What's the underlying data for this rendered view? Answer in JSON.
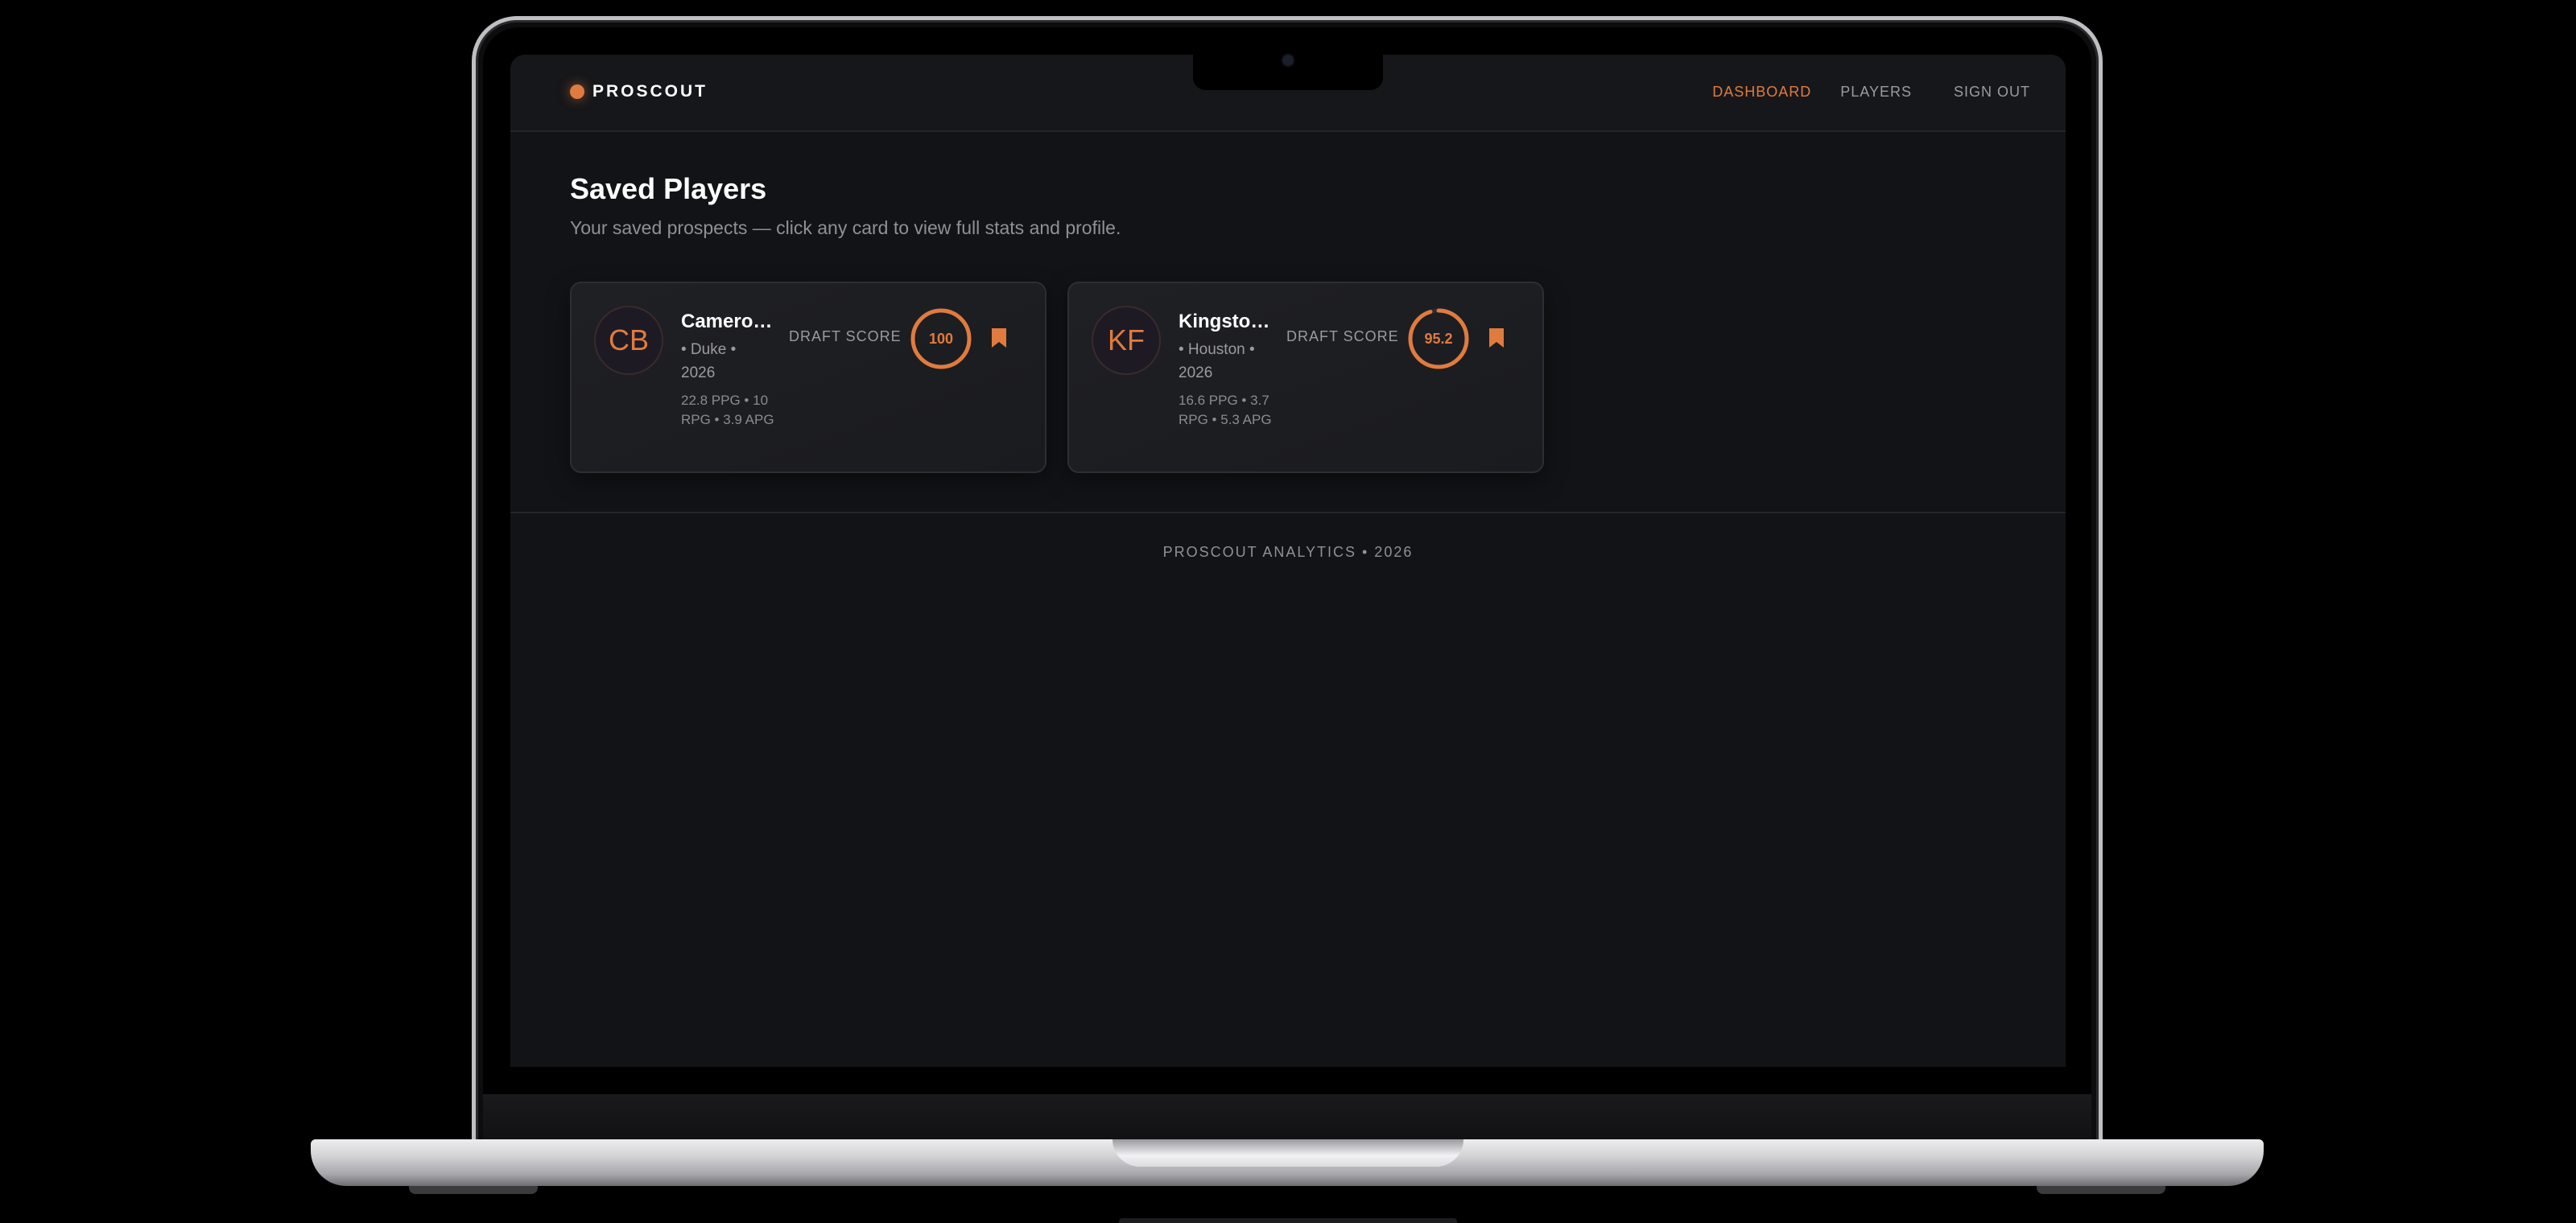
{
  "nav": {
    "brand": "PROSCOUT",
    "links": [
      {
        "label": "DASHBOARD",
        "active": true
      },
      {
        "label": "PLAYERS",
        "active": false
      },
      {
        "label": "SIGN OUT",
        "active": false
      }
    ]
  },
  "page": {
    "title": "Saved Players",
    "subtitle": "Your saved prospects — click any card to view full stats and profile."
  },
  "cards": [
    {
      "initials": "CB",
      "name": "Camero…",
      "meta": "• Duke • 2026",
      "stats": "22.8 PPG • 10 RPG • 3.9 APG",
      "score_label": "DRAFT SCORE",
      "score": "100",
      "score_fraction": 1.0,
      "bookmark_icon": "bookmark-icon"
    },
    {
      "initials": "KF",
      "name": "Kingsto…",
      "meta": "• Houston • 2026",
      "stats": "16.6 PPG • 3.7 RPG • 5.3 APG",
      "score_label": "DRAFT SCORE",
      "score": "95.2",
      "score_fraction": 0.952,
      "bookmark_icon": "bookmark-icon"
    }
  ],
  "footer": "PROSCOUT ANALYTICS • 2026",
  "colors": {
    "accent": "#e07b3f",
    "background": "#121316",
    "card": "#1d1e21"
  }
}
